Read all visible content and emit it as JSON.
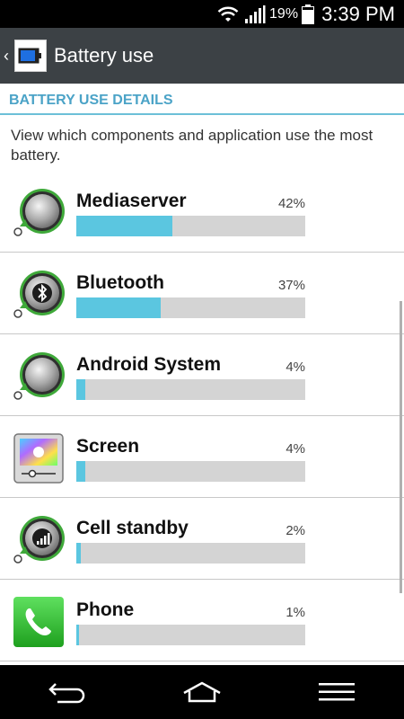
{
  "status": {
    "battery_percent": "19%",
    "time": "3:39 PM"
  },
  "header": {
    "title": "Battery use",
    "back_icon": "back-chevron-icon",
    "app_icon": "battery-icon"
  },
  "section": {
    "title": "BATTERY USE DETAILS",
    "description": "View which components and application use the most battery."
  },
  "items": [
    {
      "name": "Mediaserver",
      "percent": "42%",
      "value": 42,
      "icon": "mediaserver-icon"
    },
    {
      "name": "Bluetooth",
      "percent": "37%",
      "value": 37,
      "icon": "bluetooth-icon"
    },
    {
      "name": "Android System",
      "percent": "4%",
      "value": 4,
      "icon": "android-system-icon"
    },
    {
      "name": "Screen",
      "percent": "4%",
      "value": 4,
      "icon": "screen-icon"
    },
    {
      "name": "Cell standby",
      "percent": "2%",
      "value": 2,
      "icon": "cell-standby-icon"
    },
    {
      "name": "Phone",
      "percent": "1%",
      "value": 1,
      "icon": "phone-icon"
    }
  ],
  "colors": {
    "accent": "#4ba3c7",
    "bar_fill": "#5bc6e0",
    "bar_track": "#d4d4d4",
    "action_bar": "#3c4145"
  }
}
